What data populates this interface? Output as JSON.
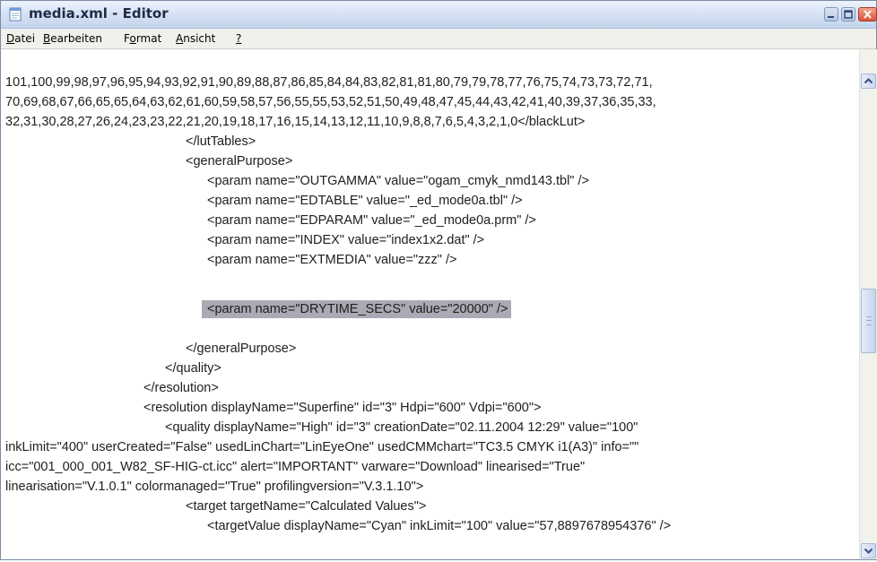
{
  "window": {
    "title": "media.xml - Editor"
  },
  "menu": [
    "Datei",
    "Bearbeiten",
    "Format",
    "Ansicht",
    "?"
  ],
  "editor": {
    "lines": [
      "101,100,99,98,97,96,95,94,93,92,91,90,89,88,87,86,85,84,84,83,82,81,81,80,79,79,78,77,76,75,74,73,73,72,71,",
      "70,69,68,67,66,65,65,64,63,62,61,60,59,58,57,56,55,55,53,52,51,50,49,48,47,45,44,43,42,41,40,39,37,36,35,33,",
      "32,31,30,28,27,26,24,23,23,22,21,20,19,18,17,16,15,14,13,12,11,10,9,8,8,7,6,5,4,3,2,1,0</blackLut>",
      "</lutTables>",
      "<generalPurpose>",
      "<param name=\"OUTGAMMA\" value=\"ogam_cmyk_nmd143.tbl\" />",
      "<param name=\"EDTABLE\" value=\"_ed_mode0a.tbl\" />",
      "<param name=\"EDPARAM\" value=\"_ed_mode0a.prm\" />",
      "<param name=\"INDEX\" value=\"index1x2.dat\" />",
      "<param name=\"EXTMEDIA\" value=\"zzz\" />",
      "",
      "<param name=\"DRYTIME_SECS\" value=\"20000\" />",
      "",
      "</generalPurpose>",
      "</quality>",
      "</resolution>",
      "<resolution displayName=\"Superfine\" id=\"3\" Hdpi=\"600\" Vdpi=\"600\">",
      "<quality displayName=\"High\" id=\"3\" creationDate=\"02.11.2004 12:29\" value=\"100\"",
      "inkLimit=\"400\" userCreated=\"False\" usedLinChart=\"LinEyeOne\" usedCMMchart=\"TC3.5 CMYK i1(A3)\" info=\"\"",
      "icc=\"001_000_001_W82_SF-HIG-ct.icc\" alert=\"IMPORTANT\" varware=\"Download\" linearised=\"True\"",
      "linearisation=\"V.1.0.1\" colormanaged=\"True\" profilingversion=\"V.3.1.10\">",
      "<target targetName=\"Calculated Values\">",
      "<targetValue displayName=\"Cyan\" inkLimit=\"100\" value=\"57,8897678954376\" />"
    ],
    "selected_line_index": 11
  },
  "icons": {
    "app": "notepad-icon",
    "minimize": "minimize-icon",
    "maximize": "maximize-icon",
    "close": "close-icon",
    "scroll_up": "scroll-up-arrow-icon",
    "scroll_down": "scroll-down-arrow-icon"
  },
  "colors": {
    "titlebar": "#c3d5ee",
    "selection": "#aaaab4",
    "close_button": "#d9553b"
  }
}
